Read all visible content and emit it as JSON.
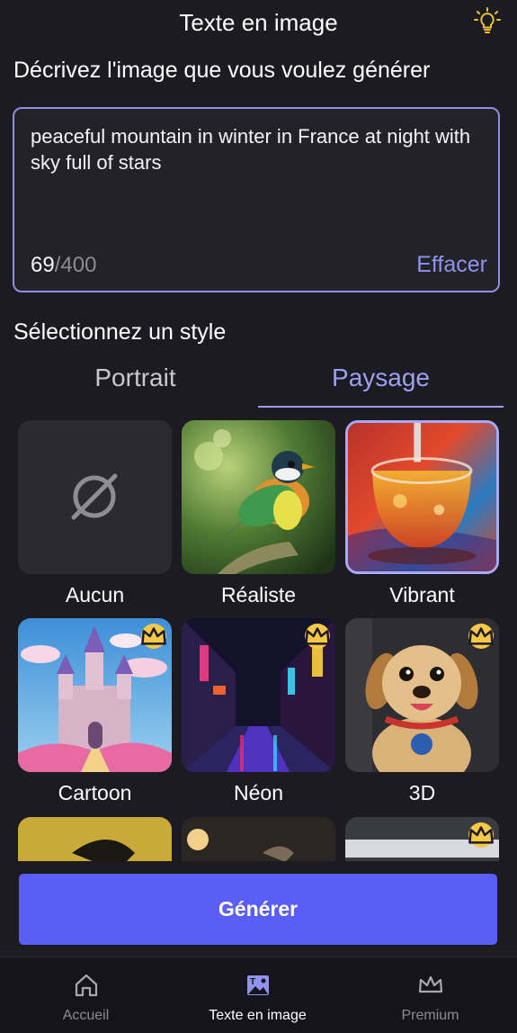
{
  "header": {
    "title": "Texte en image",
    "idea_icon": "lightbulb-icon"
  },
  "prompt": {
    "label": "Décrivez l'image que vous voulez générer",
    "text": "peaceful mountain in winter in France at night with sky full of stars",
    "count": "69",
    "max": "/400",
    "clear_label": "Effacer"
  },
  "style": {
    "label": "Sélectionnez un style",
    "tabs": [
      {
        "label": "Portrait"
      },
      {
        "label": "Paysage",
        "active": true
      }
    ],
    "items": [
      {
        "label": "Aucun",
        "icon": "none-icon"
      },
      {
        "label": "Réaliste",
        "icon": "bird-image"
      },
      {
        "label": "Vibrant",
        "icon": "glass-image",
        "selected": true
      },
      {
        "label": "Cartoon",
        "icon": "castle-image",
        "premium": true
      },
      {
        "label": "Néon",
        "icon": "neon-street-image",
        "premium": true
      },
      {
        "label": "3D",
        "icon": "puppy-image",
        "premium": true
      }
    ]
  },
  "generate_label": "Générer",
  "nav": [
    {
      "label": "Accueil",
      "icon": "home-icon"
    },
    {
      "label": "Texte en image",
      "icon": "text-to-image-icon",
      "active": true
    },
    {
      "label": "Premium",
      "icon": "crown-icon"
    }
  ],
  "colors": {
    "accent": "#5b5ef6",
    "accent_light": "#9ba0f2",
    "background": "#1c1b21",
    "premium_badge": "#f6c84a"
  }
}
